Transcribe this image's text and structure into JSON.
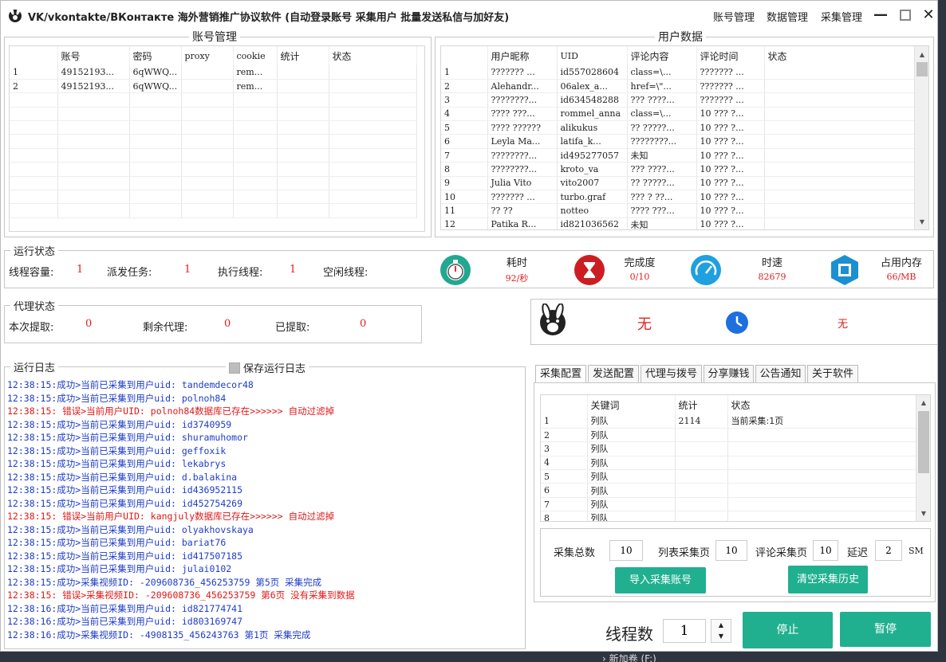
{
  "window": {
    "title": "VK/vkontakte/ВКонтакте 海外营销推广协议软件 (自动登录账号 采集用户 批量发送私信与加好友)",
    "menu": [
      "账号管理",
      "数据管理",
      "采集管理"
    ]
  },
  "account_panel": {
    "title": "账号管理",
    "columns": [
      "",
      "账号",
      "密码",
      "proxy",
      "cookie",
      "统计",
      "状态"
    ],
    "rows": [
      [
        "1",
        "49152193...",
        "6qWWQ...",
        "",
        "rem...",
        "",
        ""
      ],
      [
        "2",
        "49152193...",
        "6qWWQ...",
        "",
        "rem...",
        "",
        ""
      ]
    ]
  },
  "user_panel": {
    "title": "用户数据",
    "columns": [
      "",
      "用户昵称",
      "UID",
      "评论内容",
      "评论时间",
      "状态"
    ],
    "rows": [
      [
        "1",
        "??????? ...",
        "id557028604",
        "class=\\...",
        "??????? ...",
        ""
      ],
      [
        "2",
        "Alehandr...",
        "06alex_a...",
        "href=\\\"...",
        "??????? ...",
        ""
      ],
      [
        "3",
        "????????...",
        "id634548288",
        "??? ????...",
        "??????? ...",
        ""
      ],
      [
        "4",
        "???? ???...",
        "rommel_anna",
        "class=\\...",
        "10 ??? ?...",
        ""
      ],
      [
        "5",
        "???? ??????",
        "alikukus",
        "?? ?????...",
        "10 ??? ?...",
        ""
      ],
      [
        "6",
        "Leyla Ma...",
        "latifa_k...",
        "????????...",
        "10 ??? ?...",
        ""
      ],
      [
        "7",
        "????????...",
        "id495277057",
        "未知",
        "10 ??? ?...",
        ""
      ],
      [
        "8",
        "????????...",
        "kroto_va",
        "??? ????...",
        "10 ??? ?...",
        ""
      ],
      [
        "9",
        "Julia Vito",
        "vito2007",
        "?? ?????...",
        "10 ??? ?...",
        ""
      ],
      [
        "10",
        "??????? ...",
        "turbo.graf",
        "??? ? ??...",
        "10 ??? ?...",
        ""
      ],
      [
        "11",
        "?? ??",
        "notteo",
        "???? ???...",
        "10 ??? ?...",
        ""
      ],
      [
        "12",
        "Patika R...",
        "id821036562",
        "未知",
        "10 ??? ?...",
        ""
      ]
    ]
  },
  "run_status": {
    "title": "运行状态",
    "thread_capacity_label": "线程容量:",
    "thread_capacity": "1",
    "dispatch_label": "派发任务:",
    "dispatch": "1",
    "exec_label": "执行线程:",
    "exec": "1",
    "idle_label": "空闲线程:",
    "idle": "",
    "stats": [
      {
        "label": "耗时",
        "value": "92/秒",
        "icon": "stopwatch-icon",
        "color": "#22a890"
      },
      {
        "label": "完成度",
        "value": "0/10",
        "icon": "hourglass-icon",
        "color": "#cc1e22"
      },
      {
        "label": "时速",
        "value": "82679",
        "icon": "speedometer-icon",
        "color": "#1fa0e0"
      },
      {
        "label": "占用内存",
        "value": "66/MB",
        "icon": "memory-chip-icon",
        "color": "#1c8fd0"
      }
    ]
  },
  "proxy_status": {
    "title": "代理状态",
    "fetched_label": "本次提取:",
    "fetched": "0",
    "remain_label": "剩余代理:",
    "remain": "0",
    "extracted_label": "已提取:",
    "extracted": "0"
  },
  "info_box": {
    "left_value": "无",
    "right_value": "无"
  },
  "log_panel": {
    "title": "运行日志",
    "save_label": "保存运行日志",
    "lines": [
      {
        "t": "12:38:15:成功>当前已采集到用户uid: tandemdecor48",
        "err": false
      },
      {
        "t": "12:38:15:成功>当前已采集到用户uid: polnoh84",
        "err": false
      },
      {
        "t": "12:38:15: 错误>当前用户UID: polnoh84数据库已存在>>>>>>  自动过滤掉",
        "err": true
      },
      {
        "t": "12:38:15:成功>当前已采集到用户uid: id3740959",
        "err": false
      },
      {
        "t": "12:38:15:成功>当前已采集到用户uid: shuramuhomor",
        "err": false
      },
      {
        "t": "12:38:15:成功>当前已采集到用户uid: geffoxik",
        "err": false
      },
      {
        "t": "12:38:15:成功>当前已采集到用户uid: lekabrys",
        "err": false
      },
      {
        "t": "12:38:15:成功>当前已采集到用户uid: d.balakina",
        "err": false
      },
      {
        "t": "12:38:15:成功>当前已采集到用户uid: id436952115",
        "err": false
      },
      {
        "t": "12:38:15:成功>当前已采集到用户uid: id452754269",
        "err": false
      },
      {
        "t": "12:38:15: 错误>当前用户UID: kangjuly数据库已存在>>>>>>  自动过滤掉",
        "err": true
      },
      {
        "t": "12:38:15:成功>当前已采集到用户uid: olyakhovskaya",
        "err": false
      },
      {
        "t": "12:38:15:成功>当前已采集到用户uid: bariat76",
        "err": false
      },
      {
        "t": "12:38:15:成功>当前已采集到用户uid: id417507185",
        "err": false
      },
      {
        "t": "12:38:15:成功>当前已采集到用户uid: julai0102",
        "err": false
      },
      {
        "t": "12:38:15:成功>采集视频ID: -209608736_456253759 第5页 采集完成",
        "err": false
      },
      {
        "t": "12:38:15: 错误>采集视频ID: -209608736_456253759 第6页 没有采集到数据",
        "err": true
      },
      {
        "t": "12:38:16:成功>当前已采集到用户uid: id821774741",
        "err": false
      },
      {
        "t": "12:38:16:成功>当前已采集到用户uid: id803169747",
        "err": false
      },
      {
        "t": "12:38:16:成功>采集视频ID: -4908135_456243763 第1页 采集完成",
        "err": false
      }
    ]
  },
  "tabs": [
    "采集配置",
    "发送配置",
    "代理与拨号",
    "分享赚钱",
    "公告通知",
    "关于软件"
  ],
  "collect_panel": {
    "columns": [
      "",
      "关键词",
      "统计",
      "状态"
    ],
    "rows": [
      [
        "1",
        "列队",
        "2114",
        "当前采集:1页"
      ],
      [
        "2",
        "列队",
        "",
        ""
      ],
      [
        "3",
        "列队",
        "",
        ""
      ],
      [
        "4",
        "列队",
        "",
        ""
      ],
      [
        "5",
        "列队",
        "",
        ""
      ],
      [
        "6",
        "列队",
        "",
        ""
      ],
      [
        "7",
        "列队",
        "",
        ""
      ],
      [
        "8",
        "列队",
        "",
        ""
      ]
    ],
    "total_label": "采集总数",
    "total": "10",
    "list_pages_label": "列表采集页",
    "list_pages": "10",
    "comment_pages_label": "评论采集页",
    "comment_pages": "10",
    "delay_label": "延迟",
    "delay": "2",
    "delay_unit": "SM",
    "import_btn": "导入采集账号",
    "clear_btn": "清空采集历史"
  },
  "bottom": {
    "threads_label": "线程数",
    "threads": "1",
    "stop_btn": "停止",
    "pause_btn": "暂停"
  },
  "background": {
    "drive_label": "新加卷 (F:)"
  }
}
